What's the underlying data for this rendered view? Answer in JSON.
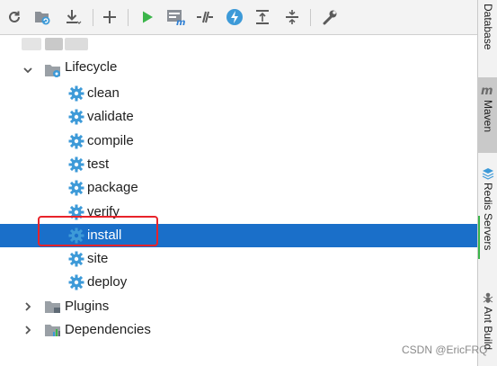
{
  "toolbar": {
    "buttons": [
      {
        "name": "reload-all-projects-button",
        "icon": "refresh-icon"
      },
      {
        "name": "reimport-folder-button",
        "icon": "folder-refresh-icon"
      },
      {
        "name": "download-sources-button",
        "icon": "download-icon"
      },
      {
        "name": "add-maven-project-button",
        "icon": "plus-icon"
      },
      {
        "name": "run-maven-build-button",
        "icon": "play-icon"
      },
      {
        "name": "execute-maven-goal-button",
        "icon": "maven-goal-icon"
      },
      {
        "name": "toggle-offline-mode-button",
        "icon": "offline-icon"
      },
      {
        "name": "skip-tests-button",
        "icon": "lightning-icon"
      },
      {
        "name": "show-dependencies-button",
        "icon": "expand-icon"
      },
      {
        "name": "collapse-all-button",
        "icon": "collapse-icon"
      },
      {
        "name": "maven-settings-button",
        "icon": "wrench-icon"
      }
    ]
  },
  "tree": {
    "lifecycle": {
      "label": "Lifecycle",
      "expanded": true
    },
    "goals": [
      "clean",
      "validate",
      "compile",
      "test",
      "package",
      "verify",
      "install",
      "site",
      "deploy"
    ],
    "selected": "install",
    "plugins": {
      "label": "Plugins",
      "expanded": false
    },
    "dependencies": {
      "label": "Dependencies",
      "expanded": false
    }
  },
  "right_tabs": [
    {
      "label": "Database",
      "active": false
    },
    {
      "label": "Maven",
      "active": true
    },
    {
      "label": "Redis Servers",
      "active": false
    },
    {
      "label": "Ant Build",
      "active": false
    }
  ],
  "watermark": "CSDN @EricFRQ",
  "colors": {
    "selection": "#1a6fc9",
    "gear": "#3d9ad8",
    "annotation": "#e8232a",
    "run": "#3bb54a"
  }
}
